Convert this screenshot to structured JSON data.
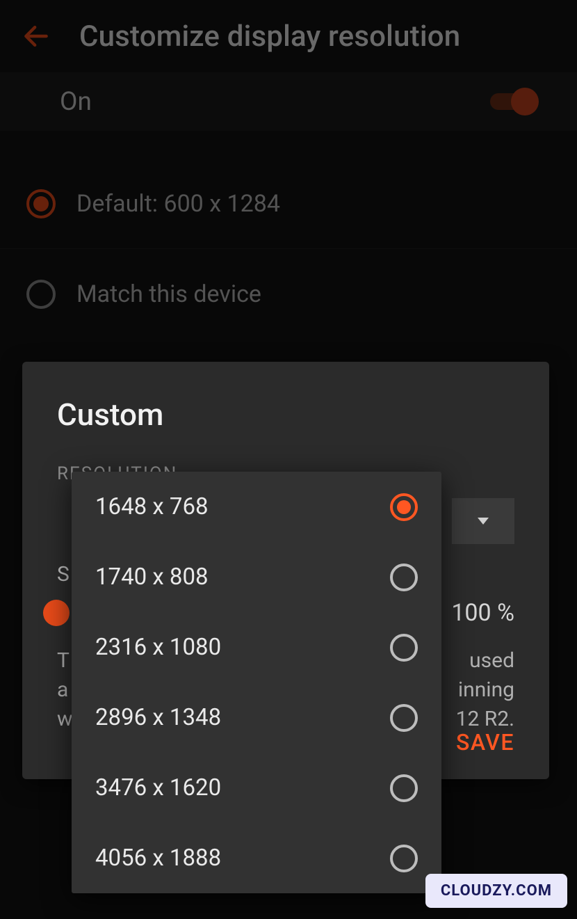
{
  "header": {
    "title": "Customize display resolution"
  },
  "toggle": {
    "label": "On",
    "state": "on"
  },
  "bg_options": [
    {
      "label": "Default: 600 x 1284",
      "selected": true
    },
    {
      "label": "Match this device",
      "selected": false
    }
  ],
  "custom_modal": {
    "title": "Custom",
    "section_label": "RESOLUTION",
    "scaling_prefix": "S",
    "scaling_value": "100 %",
    "help_fragment_1a": "T",
    "help_fragment_1b": "used",
    "help_fragment_2a": "a",
    "help_fragment_2b": "inning",
    "help_fragment_3a": "w",
    "help_fragment_3b": "12 R2.",
    "save_label": "SAVE"
  },
  "resolution_picker": {
    "options": [
      {
        "label": "1648 x 768",
        "selected": true
      },
      {
        "label": "1740 x 808",
        "selected": false
      },
      {
        "label": "2316 x 1080",
        "selected": false
      },
      {
        "label": "2896 x 1348",
        "selected": false
      },
      {
        "label": "3476 x 1620",
        "selected": false
      },
      {
        "label": "4056 x 1888",
        "selected": false
      }
    ]
  },
  "watermark": "CLOUDZY.COM"
}
